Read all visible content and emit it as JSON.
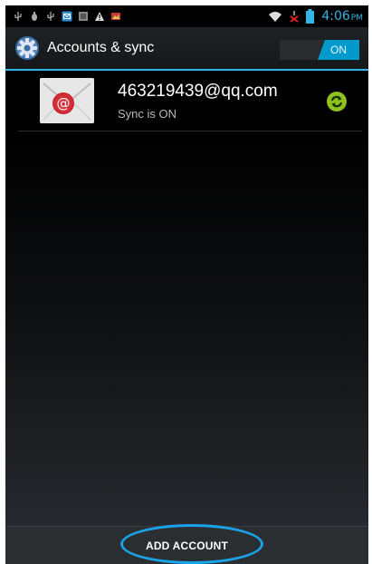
{
  "status_bar": {
    "icons_left": [
      "usb-icon",
      "debug-icon",
      "usb-icon",
      "email-notification-icon",
      "storage-icon",
      "warning-icon",
      "photo-icon"
    ],
    "icons_right": [
      "wifi-icon",
      "signal-off-icon",
      "battery-icon"
    ],
    "time": "4:06",
    "ampm": "PM",
    "accent_color": "#33b5e5"
  },
  "action_bar": {
    "title": "Accounts & sync",
    "icon": "settings-gear-icon",
    "toggle_on_label": "ON",
    "accent_color": "#33b5e5"
  },
  "accounts": [
    {
      "email": "463219439@qq.com",
      "status": "Sync is ON",
      "icon": "email-app-icon",
      "sync_icon": "sync-icon",
      "sync_color": "#8ec11a"
    }
  ],
  "bottom_bar": {
    "button_label": "ADD ACCOUNT",
    "highlight_color": "#1aa3e8"
  }
}
